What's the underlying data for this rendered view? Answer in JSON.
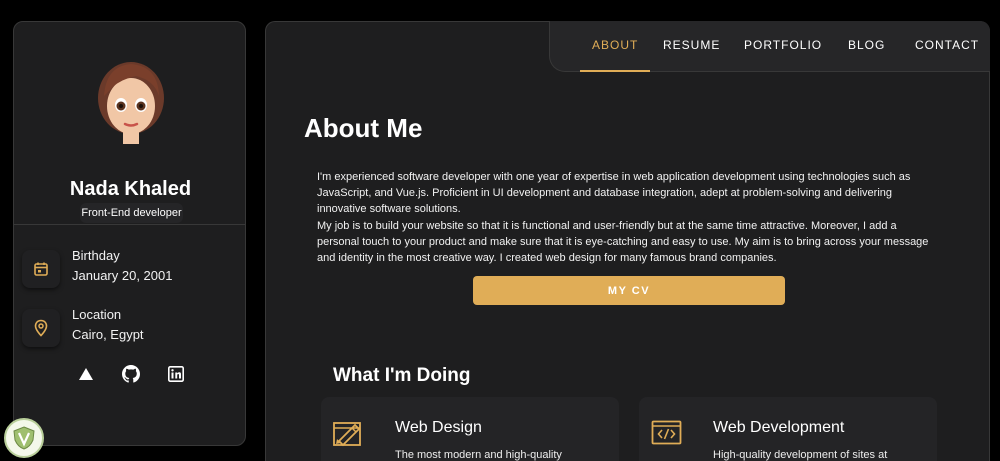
{
  "profile": {
    "name": "Nada Khaled",
    "role": "Front-End developer"
  },
  "contacts": [
    {
      "title": "Birthday",
      "value": "January 20, 2001",
      "icon": "calendar-icon"
    },
    {
      "title": "Location",
      "value": "Cairo, Egypt",
      "icon": "location-icon"
    }
  ],
  "socials": [
    "triangle-icon",
    "github-icon",
    "linkedin-icon"
  ],
  "nav": {
    "items": [
      "ABOUT",
      "RESUME",
      "PORTFOLIO",
      "BLOG",
      "CONTACT"
    ],
    "active": "ABOUT"
  },
  "about": {
    "title": "About Me",
    "paragraphs": [
      "I'm experienced software developer with one year of expertise in web application development using technologies such as JavaScript, and Vue.js. Proficient in UI development and database integration, adept at problem-solving and delivering innovative software solutions.",
      "My job is to build your website so that it is functional and user-friendly but at the same time attractive. Moreover, I add a personal touch to your product and make sure that it is eye-catching and easy to use. My aim is to bring across your message and identity in the most creative way. I created web design for many famous brand companies."
    ],
    "cv_button": "MY CV"
  },
  "services": {
    "title": "What I'm Doing",
    "items": [
      {
        "title": "Web Design",
        "text": "The most modern and high-quality",
        "icon": "design-icon"
      },
      {
        "title": "Web Development",
        "text": "High-quality development of sites at",
        "icon": "code-icon"
      }
    ]
  },
  "colors": {
    "accent": "#e0ad57",
    "background": "#1e1e1f",
    "page": "#000000"
  }
}
